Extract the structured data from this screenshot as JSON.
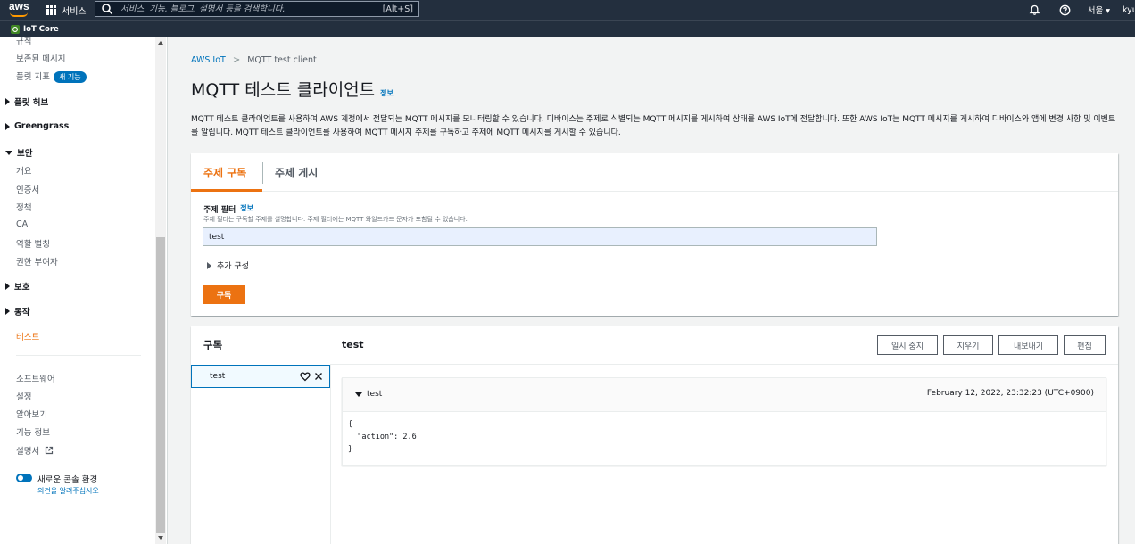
{
  "topnav": {
    "logo": "aws",
    "services_label": "서비스",
    "search_placeholder": "서비스, 기능, 블로그, 설명서 등을 검색합니다.",
    "search_shortcut": "[Alt+S]",
    "region": "서울 ▾",
    "user": "kyu"
  },
  "servicebar": {
    "service_name": "IoT Core"
  },
  "sidebar": {
    "items": {
      "rules_partial": "규칙",
      "retained": "보존된 메시지",
      "fleet_metrics": "플릿 지표",
      "new_badge": "새 기능",
      "fleet_hub": "플릿 허브",
      "greengrass": "Greengrass",
      "security": "보안",
      "overview": "개요",
      "certs": "인증서",
      "policies": "정책",
      "ca": "CA",
      "role_alias": "역할 별칭",
      "authorizers": "권한 부여자",
      "defend": "보호",
      "act": "동작",
      "test": "테스트",
      "software": "소프트웨어",
      "settings": "설정",
      "learn": "알아보기",
      "feature_spotlight": "기능 정보",
      "docs": "설명서",
      "new_console": "새로운 콘솔 환경",
      "feedback": "의견을 알려주십시오"
    }
  },
  "main": {
    "breadcrumb": {
      "root": "AWS IoT",
      "sep": ">",
      "current": "MQTT test client"
    },
    "title": "MQTT 테스트 클라이언트",
    "info": "정보",
    "description": "MQTT 테스트 클라이언트를 사용하여 AWS 계정에서 전달되는 MQTT 메시지를 모니터링할 수 있습니다. 디바이스는 주제로 식별되는 MQTT 메시지를 게시하여 상태를 AWS IoT에 전달합니다. 또한 AWS IoT는 MQTT 메시지를 게시하여 디바이스와 앱에 변경 사항 및 이벤트를 알립니다. MQTT 테스트 클라이언트를 사용하여 MQTT 메시지 주제를 구독하고 주제에 MQTT 메시지를 게시할 수 있습니다.",
    "tabs": {
      "subscribe": "주제 구독",
      "publish": "주제 게시"
    },
    "form": {
      "filter_label": "주제 필터",
      "filter_info": "정보",
      "filter_desc": "주제 필터는 구독할 주제를 설명합니다. 주제 필터에는 MQTT 와일드카드 문자가 포함될 수 있습니다.",
      "filter_value": "test",
      "additional": "추가 구성",
      "subscribe_btn": "구독"
    },
    "subscriptions": {
      "title": "구독",
      "items": [
        {
          "topic": "test"
        }
      ],
      "selected_topic": "test",
      "buttons": {
        "pause": "일시 중지",
        "clear": "지우기",
        "export": "내보내기",
        "edit": "편집"
      },
      "messages": [
        {
          "topic": "test",
          "timestamp": "February 12, 2022, 23:32:23 (UTC+0900)",
          "body": "{\n  \"action\": 2.6\n}"
        }
      ]
    }
  },
  "colors": {
    "nav_bg": "#232f3e",
    "accent": "#ec7211",
    "link": "#0073bb"
  }
}
